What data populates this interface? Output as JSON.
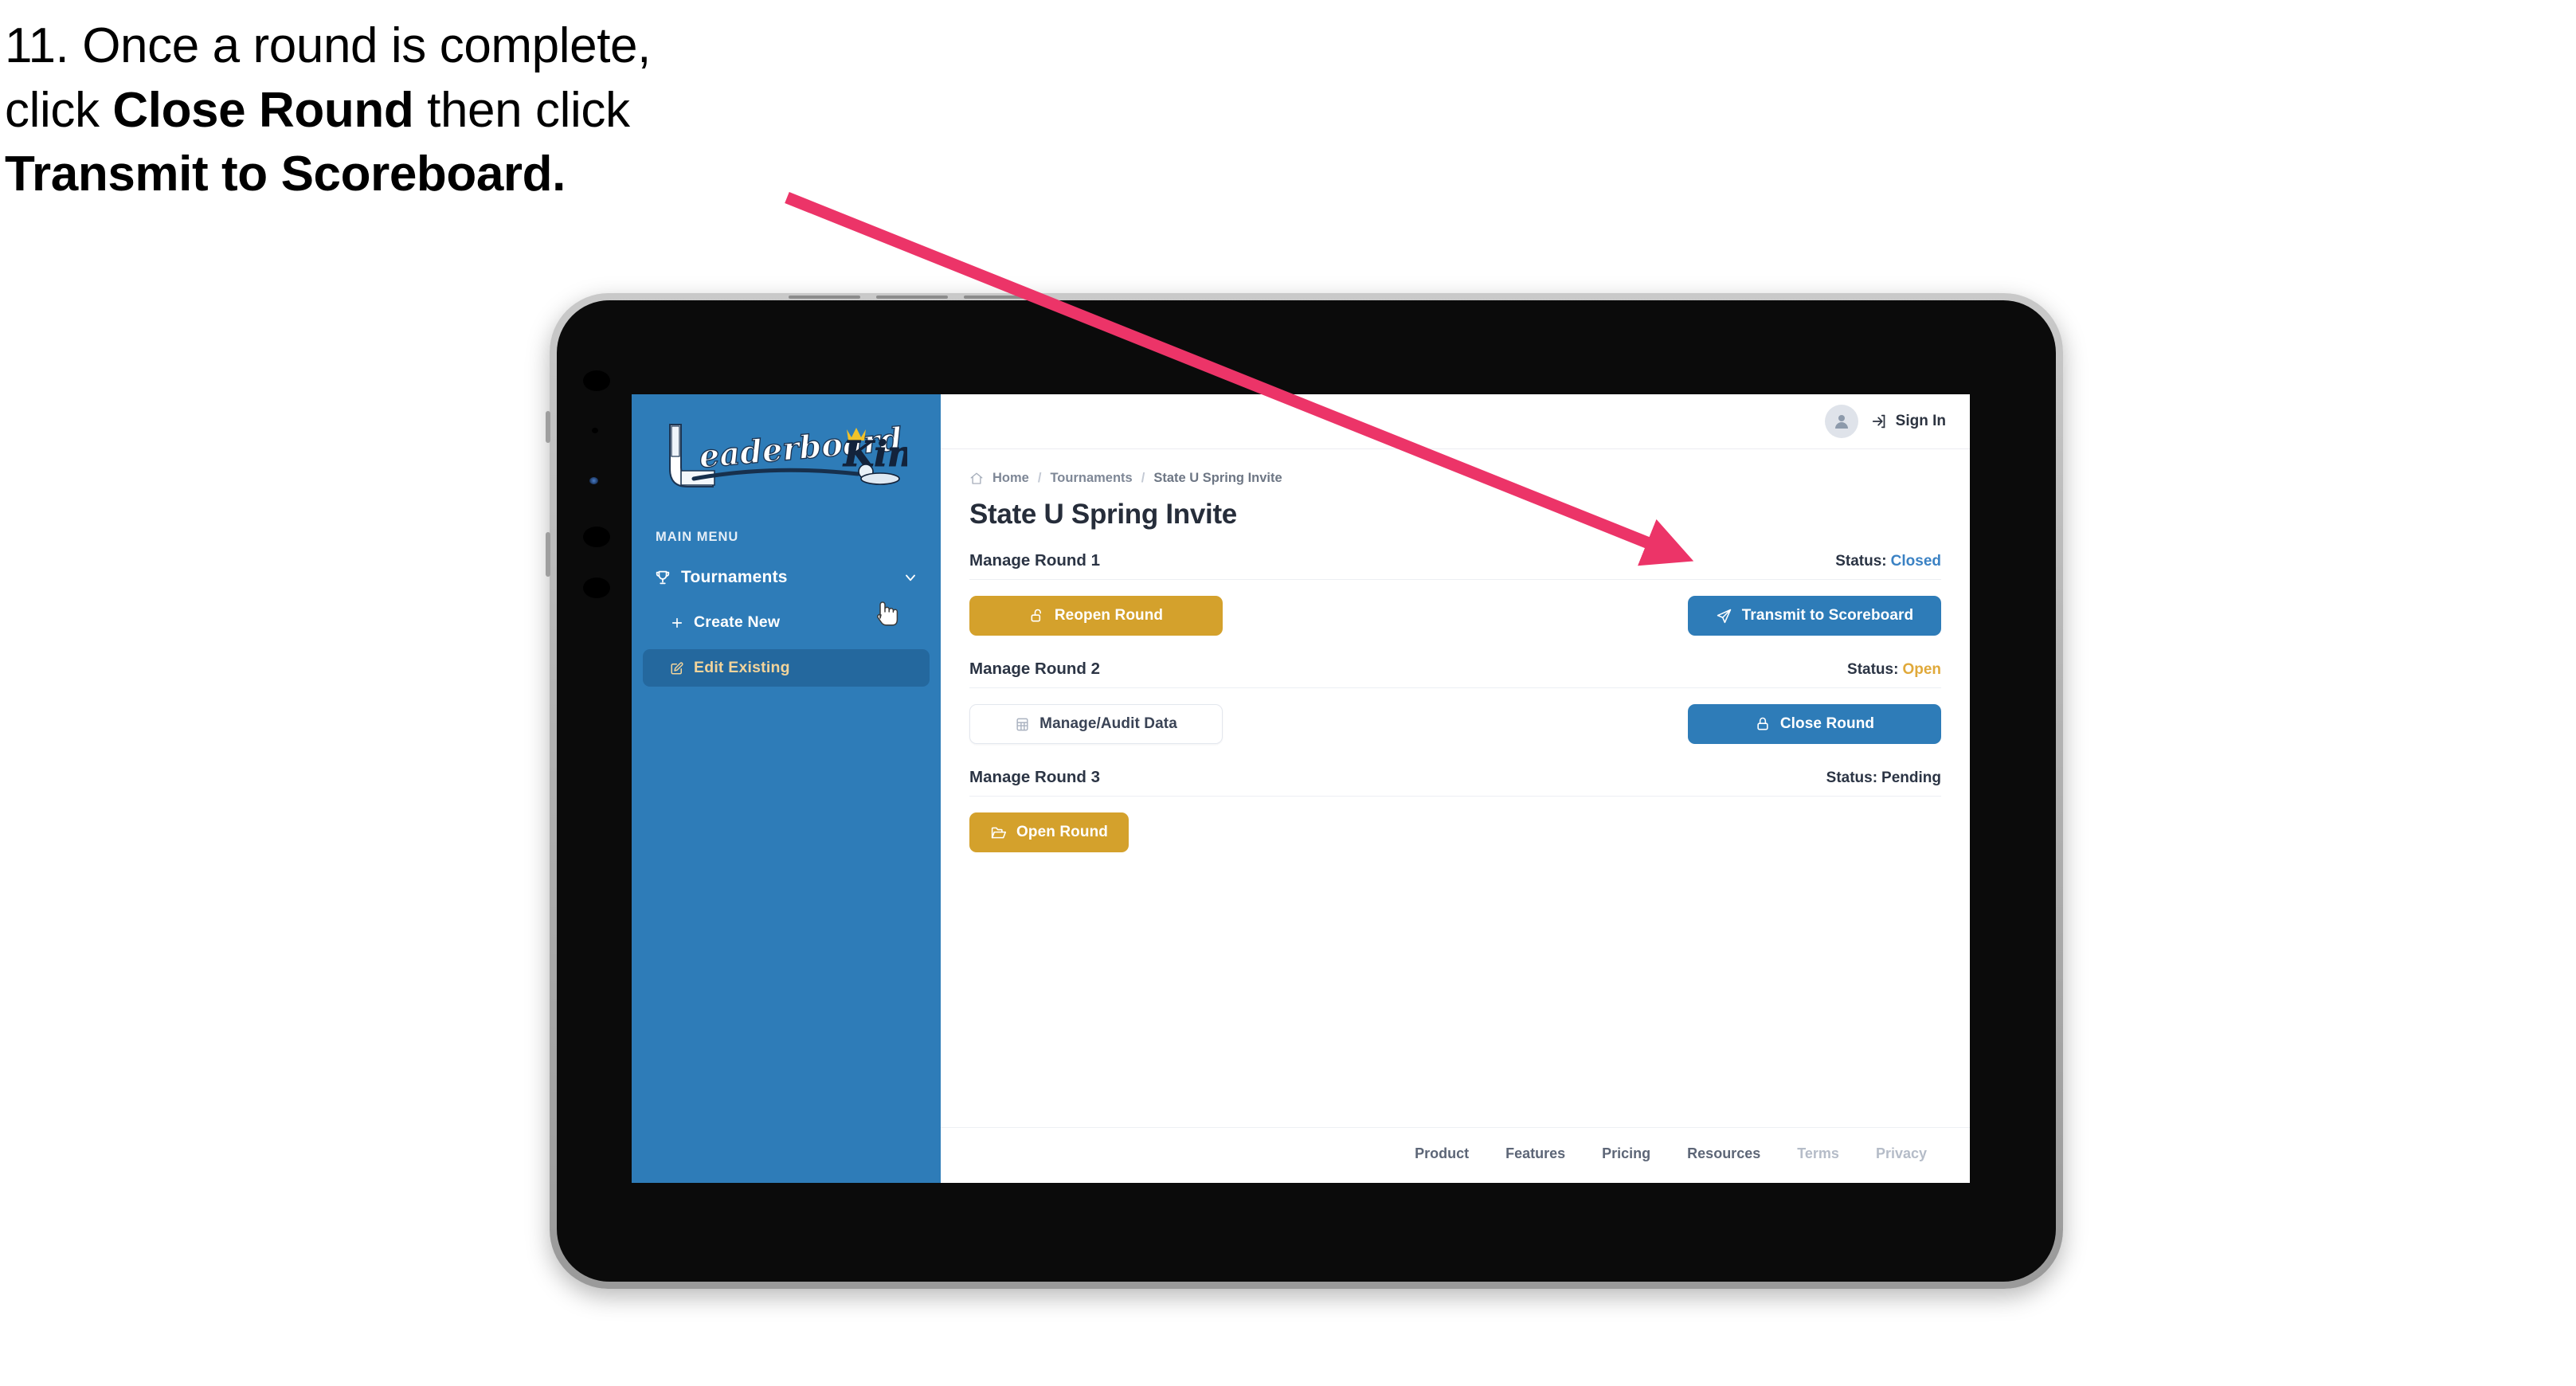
{
  "caption": {
    "line1_prefix": "11. Once a round is complete,",
    "line2_prefix": "click ",
    "line2_bold": "Close Round",
    "line2_suffix": " then click",
    "line3_bold": "Transmit to Scoreboard."
  },
  "annotation": {
    "arrow_color": "#EC3468",
    "arrow_points_to": "transmit-to-scoreboard-button"
  },
  "device": {
    "type": "tablet",
    "bezel_color": "#0b0b0b",
    "frame_color": "#b4b4b4"
  },
  "sidebar": {
    "brand": {
      "name_primary": "Leaderboard",
      "name_secondary": "King",
      "icon": "golf-club-icon",
      "crown_icon": "crown-icon",
      "crown_color": "#F2C229"
    },
    "section_label": "MAIN MENU",
    "background_color": "#2E7CB8",
    "nav": [
      {
        "label": "Tournaments",
        "icon": "trophy-icon",
        "expander_icon": "chevron-down-icon",
        "expanded": true
      }
    ],
    "sub_items": [
      {
        "label": "Create New",
        "icon": "plus-icon",
        "active": false
      },
      {
        "label": "Edit Existing",
        "icon": "edit-pencil-icon",
        "active": true
      }
    ],
    "active_item_color": "#F2D49B",
    "active_item_bg": "#24689E",
    "cursor": "pointing-hand-cursor"
  },
  "topbar": {
    "avatar_icon": "user-avatar-icon",
    "signin_icon": "login-arrow-icon",
    "signin_label": "Sign In"
  },
  "breadcrumb": {
    "home_icon": "home-icon",
    "items": [
      "Home",
      "Tournaments",
      "State U Spring Invite"
    ],
    "separator": "/"
  },
  "page": {
    "title": "State U Spring Invite"
  },
  "rounds": [
    {
      "title": "Manage Round 1",
      "status_label": "Status:",
      "status_value": "Closed",
      "status_color": "#3B82C4",
      "left_button": {
        "label": "Reopen Round",
        "icon": "unlock-icon",
        "style": "gold"
      },
      "right_button": {
        "label": "Transmit to Scoreboard",
        "icon": "paper-plane-icon",
        "style": "blue"
      }
    },
    {
      "title": "Manage Round 2",
      "status_label": "Status:",
      "status_value": "Open",
      "status_color": "#E0A93A",
      "left_button": {
        "label": "Manage/Audit Data",
        "icon": "table-grid-icon",
        "style": "ghost"
      },
      "right_button": {
        "label": "Close Round",
        "icon": "lock-icon",
        "style": "blue"
      }
    },
    {
      "title": "Manage Round 3",
      "status_label": "Status:",
      "status_value": "Pending",
      "status_color": "#2b3444",
      "left_button": {
        "label": "Open Round",
        "icon": "open-folder-icon",
        "style": "gold"
      },
      "right_button": null
    }
  ],
  "footer": {
    "links": [
      {
        "label": "Product",
        "muted": false
      },
      {
        "label": "Features",
        "muted": false
      },
      {
        "label": "Pricing",
        "muted": false
      },
      {
        "label": "Resources",
        "muted": false
      },
      {
        "label": "Terms",
        "muted": true
      },
      {
        "label": "Privacy",
        "muted": true
      }
    ]
  },
  "colors": {
    "brand_blue": "#2E7CB8",
    "brand_gold": "#D4A12C",
    "accent_pink": "#EC3468",
    "text_dark": "#262D3A"
  }
}
